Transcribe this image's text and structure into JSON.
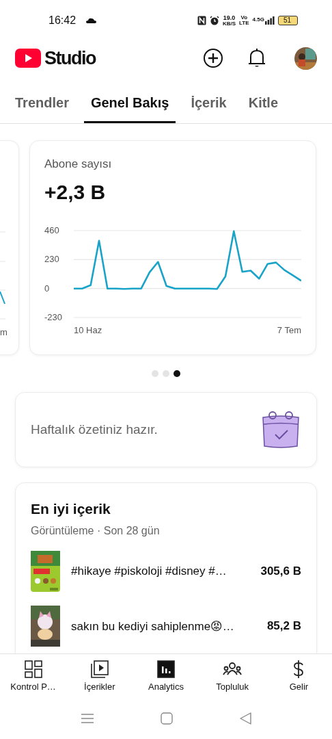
{
  "status_bar": {
    "time": "16:42",
    "speed": "19.0",
    "speed_unit": "KB/S",
    "volte": "Vo",
    "volte_sub": "LTE",
    "network": "4.5G",
    "battery": "51"
  },
  "header": {
    "logo_text": "Studio"
  },
  "tabs": [
    {
      "label": "Trendler",
      "selected": false
    },
    {
      "label": "Genel Bakış",
      "selected": true
    },
    {
      "label": "İçerik",
      "selected": false
    },
    {
      "label": "Kitle",
      "selected": false
    }
  ],
  "carousel": {
    "previous_card": {
      "axis_label": "m"
    },
    "card": {
      "title": "Abone sayısı",
      "value": "+2,3 B",
      "chart_data": {
        "type": "line",
        "series": [
          {
            "color": "#1aa3c8",
            "values": [
              0,
              0,
              27,
              380,
              0,
              0,
              -3,
              0,
              0,
              129,
              211,
              20,
              0,
              0,
              0,
              0,
              0,
              -3,
              96,
              455,
              133,
              142,
              78,
              195,
              207,
              147,
              105,
              62
            ]
          }
        ],
        "ylim": [
          -230,
          460
        ],
        "yticks": [
          -230,
          0,
          230,
          460
        ]
      },
      "x_axis_labels": [
        "10 Haz",
        "7 Tem"
      ]
    },
    "dots": [
      {
        "selected": false
      },
      {
        "selected": false
      },
      {
        "selected": true
      }
    ]
  },
  "weekly_card": {
    "text": "Haftalık özetiniz hazır."
  },
  "top_content": {
    "title": "En iyi içerik",
    "subtitle": "Görüntüleme · Son 28 gün",
    "items": [
      {
        "title": "#hikaye #piskoloji #disney #…",
        "views": "305,6 B"
      },
      {
        "title": "sakın bu kediyi sahiplenme😡…",
        "views": "85,2 B"
      }
    ]
  },
  "bottom_nav": [
    {
      "label": "Kontrol P…",
      "selected": false
    },
    {
      "label": "İçerikler",
      "selected": false
    },
    {
      "label": "Analytics",
      "selected": true
    },
    {
      "label": "Topluluk",
      "selected": false
    },
    {
      "label": "Gelir",
      "selected": false
    }
  ]
}
